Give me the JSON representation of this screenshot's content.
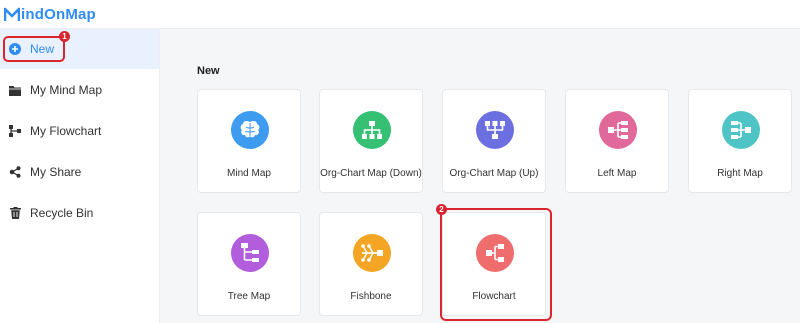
{
  "app": {
    "logo_text": "indOnMap",
    "brand_color": "#2f8cf3"
  },
  "sidebar": {
    "items": [
      {
        "label": "New",
        "icon": "plus-circle-icon",
        "active": true
      },
      {
        "label": "My Mind Map",
        "icon": "folder-icon"
      },
      {
        "label": "My Flowchart",
        "icon": "flowchart-icon"
      },
      {
        "label": "My Share",
        "icon": "share-icon"
      },
      {
        "label": "Recycle Bin",
        "icon": "trash-icon"
      }
    ]
  },
  "annotations": {
    "step1": "1",
    "step2": "2",
    "highlight_color": "#d9262e"
  },
  "main": {
    "section_title": "New",
    "templates": [
      {
        "label": "Mind Map",
        "icon": "brain-icon",
        "color": "#3d9bf0"
      },
      {
        "label": "Org-Chart Map (Down)",
        "icon": "org-chart-down-icon",
        "color": "#35c073"
      },
      {
        "label": "Org-Chart Map (Up)",
        "icon": "org-chart-up-icon",
        "color": "#6c6fe0"
      },
      {
        "label": "Left Map",
        "icon": "left-map-icon",
        "color": "#e0689a"
      },
      {
        "label": "Right Map",
        "icon": "right-map-icon",
        "color": "#4fc4c6"
      },
      {
        "label": "Tree Map",
        "icon": "tree-map-icon",
        "color": "#b15ddc"
      },
      {
        "label": "Fishbone",
        "icon": "fishbone-icon",
        "color": "#f3a523"
      },
      {
        "label": "Flowchart",
        "icon": "flowchart-template-icon",
        "color": "#f06d6d"
      }
    ]
  }
}
